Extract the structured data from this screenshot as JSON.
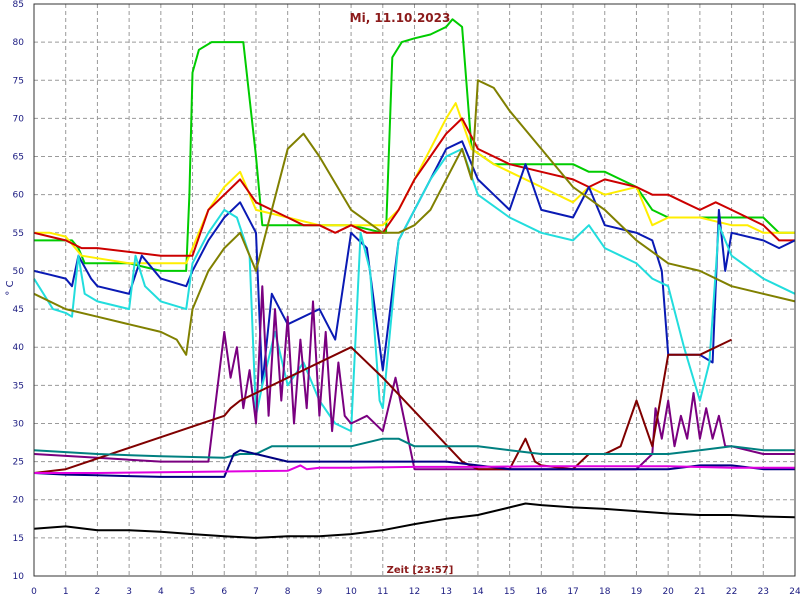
{
  "chart_data": {
    "type": "line",
    "title": "Mi, 11.10.2023",
    "xlabel": "Zeit [23:57]",
    "ylabel": "° C",
    "xlim": [
      0,
      24
    ],
    "ylim": [
      10,
      85
    ],
    "xticks": [
      0,
      1,
      2,
      3,
      4,
      5,
      6,
      7,
      8,
      9,
      10,
      11,
      12,
      13,
      14,
      15,
      16,
      17,
      18,
      19,
      20,
      21,
      22,
      23,
      24
    ],
    "yticks": [
      10,
      15,
      20,
      25,
      30,
      35,
      40,
      45,
      50,
      55,
      60,
      65,
      70,
      75,
      80,
      85
    ],
    "grid": true,
    "colors": {
      "background": "#ffffff",
      "grid": "#9a9a9a",
      "tick_text": "#1a1a80",
      "title_text": "#8b1a1a"
    },
    "series": [
      {
        "color": "#00cc00",
        "x": [
          0,
          1.2,
          1.4,
          1.6,
          3,
          3.5,
          4,
          4.8,
          4.9,
          5.0,
          5.2,
          5.6,
          6,
          6.4,
          6.6,
          7,
          7.2,
          7.5,
          8,
          10,
          11,
          11.1,
          11.3,
          11.6,
          12,
          12.5,
          13,
          13.2,
          13.5,
          13.8,
          14.5,
          15,
          16,
          17,
          17.5,
          18,
          18.5,
          19,
          19.5,
          20,
          21,
          22,
          23,
          23.5,
          24
        ],
        "y": [
          54,
          54,
          53,
          51,
          51,
          50.5,
          50,
          50,
          60,
          76,
          79,
          80,
          80,
          80,
          80,
          65,
          56,
          56,
          56,
          56,
          55,
          55,
          78,
          80,
          80.5,
          81,
          82,
          83,
          82,
          66,
          64,
          64,
          64,
          64,
          63,
          63,
          62,
          61,
          58,
          57,
          57,
          57,
          57,
          55,
          55
        ]
      },
      {
        "color": "#ffee00",
        "x": [
          0,
          0.5,
          1,
          1.5,
          3,
          4,
          4.8,
          5,
          5.5,
          6,
          6.5,
          7,
          8,
          9,
          10,
          11,
          11.5,
          12,
          12.5,
          13,
          13.3,
          13.8,
          14.5,
          15,
          16,
          17,
          17.5,
          18,
          19,
          19.5,
          20,
          21,
          22,
          22.5,
          23,
          23.5,
          24
        ],
        "y": [
          55,
          55,
          54.5,
          52,
          51,
          51,
          51,
          53,
          58,
          61,
          63,
          58,
          57,
          56,
          56,
          56,
          58,
          62,
          66,
          70,
          72,
          66,
          64,
          63,
          61,
          59,
          61,
          60,
          61,
          56,
          57,
          57,
          56,
          56,
          55,
          55,
          55
        ]
      },
      {
        "color": "#cc0000",
        "x": [
          0,
          0.5,
          1,
          1.5,
          2,
          3,
          4,
          5,
          5.5,
          6,
          6.5,
          7,
          7.5,
          8,
          8.5,
          9,
          9.5,
          10,
          10.5,
          11,
          11.5,
          12,
          12.5,
          13,
          13.5,
          14,
          15,
          16,
          17,
          17.5,
          18,
          19,
          19.5,
          20,
          20.5,
          21,
          21.5,
          22,
          22.5,
          23,
          23.5,
          24
        ],
        "y": [
          55,
          54.5,
          54,
          53,
          53,
          52.5,
          52,
          52,
          58,
          60,
          62,
          59,
          58,
          57,
          56,
          56,
          55,
          56,
          55,
          55,
          58,
          62,
          65,
          68,
          70,
          66,
          64,
          63,
          62,
          61,
          62,
          61,
          60,
          60,
          59,
          58,
          59,
          58,
          57,
          56,
          54,
          54
        ]
      },
      {
        "color": "#0a1ab4",
        "x": [
          0,
          0.5,
          1,
          1.2,
          1.4,
          1.8,
          2,
          3,
          3.4,
          4,
          4.8,
          5,
          5.5,
          6,
          6.5,
          7,
          7.2,
          7.5,
          8,
          9,
          9.5,
          10,
          10.5,
          11,
          11.5,
          12,
          12.5,
          13,
          13.5,
          14,
          14.5,
          15,
          15.5,
          16,
          17,
          17.5,
          18,
          19,
          19.5,
          19.8,
          20,
          21,
          21.4,
          21.6,
          21.8,
          22,
          23,
          23.5,
          24
        ],
        "y": [
          50,
          49.5,
          49,
          48,
          52,
          49,
          48,
          47,
          52,
          49,
          48,
          50,
          54,
          57,
          59,
          55,
          35,
          47,
          43,
          45,
          41,
          55,
          53,
          37,
          54,
          58,
          62,
          66,
          67,
          62,
          60,
          58,
          64,
          58,
          57,
          61,
          56,
          55,
          54,
          50,
          39,
          39,
          38,
          58,
          50,
          55,
          54,
          53,
          54
        ]
      },
      {
        "color": "#22dddd",
        "x": [
          0,
          0.3,
          0.6,
          1,
          1.2,
          1.4,
          1.6,
          2,
          3,
          3.2,
          3.5,
          4,
          4.8,
          5,
          5.5,
          6,
          6.4,
          6.8,
          7,
          7.2,
          7.6,
          8,
          8.5,
          9,
          9.5,
          10,
          10.3,
          10.6,
          10.9,
          11,
          11.5,
          12,
          12.5,
          13,
          13.5,
          14,
          15,
          16,
          17,
          17.5,
          18,
          18.5,
          19,
          19.5,
          20,
          20.5,
          21,
          21.3,
          21.6,
          22,
          23,
          23.5,
          24
        ],
        "y": [
          49,
          47,
          45,
          44.5,
          44,
          52,
          47,
          46,
          45,
          52,
          48,
          46,
          45,
          51,
          55,
          58,
          57,
          52,
          31,
          35,
          42,
          35,
          38,
          33,
          30,
          29,
          55,
          50,
          33,
          32,
          54,
          58,
          62,
          65,
          66,
          60,
          57,
          55,
          54,
          56,
          53,
          52,
          51,
          49,
          48,
          40,
          33,
          38,
          56,
          52,
          49,
          48,
          47
        ]
      },
      {
        "color": "#808000",
        "x": [
          0,
          1,
          2,
          3,
          4,
          4.5,
          4.8,
          5,
          5.5,
          6,
          6.5,
          7,
          7.5,
          8,
          8.5,
          9,
          10,
          11,
          11.5,
          12,
          12.5,
          13,
          13.5,
          13.8,
          14,
          14.5,
          15,
          16,
          17,
          18,
          19,
          20,
          21,
          22,
          23,
          24
        ],
        "y": [
          47,
          45,
          44,
          43,
          42,
          41,
          39,
          45,
          50,
          53,
          55,
          50,
          58,
          66,
          68,
          65,
          58,
          55,
          55,
          56,
          58,
          62,
          66,
          62,
          75,
          74,
          71,
          66,
          61,
          58,
          54,
          51,
          50,
          48,
          47,
          46
        ]
      },
      {
        "color": "#7a0080",
        "x": [
          0,
          2,
          4,
          5.5,
          6,
          6.2,
          6.4,
          6.6,
          6.8,
          7,
          7.2,
          7.4,
          7.6,
          7.8,
          8,
          8.2,
          8.4,
          8.6,
          8.8,
          9,
          9.2,
          9.4,
          9.6,
          9.8,
          10,
          10.5,
          11,
          11.4,
          11.7,
          12,
          14,
          18,
          19,
          19.5,
          19.6,
          19.8,
          20,
          20.2,
          20.4,
          20.6,
          20.8,
          21,
          21.2,
          21.4,
          21.6,
          21.8,
          22,
          23,
          24
        ],
        "y": [
          26,
          25.5,
          25,
          25,
          42,
          36,
          40,
          32,
          37,
          30,
          48,
          31,
          45,
          33,
          44,
          30,
          41,
          32,
          46,
          31,
          42,
          29,
          38,
          31,
          30,
          31,
          29,
          36,
          30,
          24,
          24,
          24,
          24,
          26,
          32,
          28,
          33,
          27,
          31,
          28,
          34,
          28,
          32,
          28,
          31,
          27,
          27,
          26,
          26
        ]
      },
      {
        "color": "#800000",
        "x": [
          0,
          1,
          6,
          6.2,
          6.5,
          7,
          10,
          11,
          13.5,
          14,
          15,
          15.5,
          15.8,
          16,
          17,
          17.5,
          18,
          18.5,
          19,
          19.5,
          20,
          21,
          22
        ],
        "y": [
          23.5,
          24,
          31,
          32,
          33,
          34,
          40,
          36,
          25,
          24,
          24,
          28,
          25,
          24.5,
          24,
          26,
          26,
          27,
          33,
          27,
          39,
          39,
          41
        ]
      },
      {
        "color": "#008080",
        "x": [
          0,
          2,
          4,
          6,
          6.5,
          7,
          7.5,
          8,
          9,
          10,
          11,
          11.5,
          12,
          14,
          15,
          16,
          17,
          18,
          19,
          20,
          21,
          22,
          23,
          24
        ],
        "y": [
          26.5,
          26,
          25.7,
          25.5,
          26,
          26,
          27,
          27,
          27,
          27,
          28,
          28,
          27,
          27,
          26.5,
          26,
          26,
          26,
          26,
          26,
          26.5,
          27,
          26.5,
          26.5
        ]
      },
      {
        "color": "#000080",
        "x": [
          0,
          1,
          2,
          3,
          4,
          5,
          6,
          6.3,
          6.5,
          7,
          8,
          9,
          10,
          11,
          12,
          13,
          14,
          15,
          16,
          17,
          18,
          19,
          20,
          21,
          22,
          23,
          24
        ],
        "y": [
          23.5,
          23.3,
          23.2,
          23.1,
          23,
          23,
          23,
          26,
          26.5,
          26,
          25,
          25,
          25,
          25,
          25,
          25,
          24.5,
          24,
          24,
          24,
          24,
          24,
          24,
          24.5,
          24.5,
          24,
          24
        ]
      },
      {
        "color": "#e000e0",
        "x": [
          0,
          2,
          4,
          6,
          8,
          8.4,
          8.6,
          9,
          10,
          12,
          14,
          16,
          18,
          20,
          22,
          24
        ],
        "y": [
          23.5,
          23.5,
          23.6,
          23.7,
          23.8,
          24.5,
          24,
          24.2,
          24.2,
          24.3,
          24.3,
          24.4,
          24.4,
          24.4,
          24.2,
          24.2
        ]
      },
      {
        "color": "#000000",
        "x": [
          0,
          1,
          2,
          3,
          4,
          5,
          6,
          7,
          8,
          9,
          10,
          11,
          12,
          13,
          14,
          15,
          15.5,
          16,
          17,
          18,
          19,
          20,
          21,
          22,
          23,
          24
        ],
        "y": [
          16.2,
          16.5,
          16,
          16,
          15.8,
          15.5,
          15.2,
          15,
          15.2,
          15.2,
          15.5,
          16,
          16.8,
          17.5,
          18,
          19,
          19.5,
          19.3,
          19,
          18.8,
          18.5,
          18.2,
          18,
          18,
          17.8,
          17.7
        ]
      }
    ]
  }
}
